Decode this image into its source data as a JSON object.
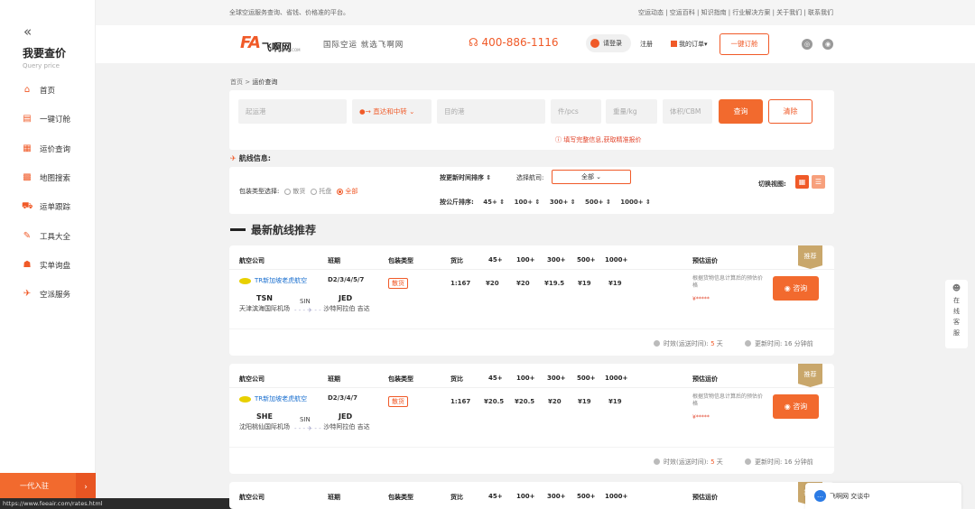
{
  "sidebar": {
    "collapse_glyph": "«",
    "title": "我要查价",
    "subtitle": "Query price",
    "items": [
      {
        "label": "首页",
        "icon": "home-icon",
        "glyph": "⌂"
      },
      {
        "label": "一键订舱",
        "icon": "booking-icon",
        "glyph": "▤"
      },
      {
        "label": "运价查询",
        "icon": "freight-rate-icon",
        "glyph": "▦"
      },
      {
        "label": "地图搜索",
        "icon": "map-icon",
        "glyph": "▩"
      },
      {
        "label": "运单跟踪",
        "icon": "truck-icon",
        "glyph": "⛟"
      },
      {
        "label": "工具大全",
        "icon": "wrench-icon",
        "glyph": "✎"
      },
      {
        "label": "实单询盘",
        "icon": "inquiry-icon",
        "glyph": "☗"
      },
      {
        "label": "空派服务",
        "icon": "plane-icon",
        "glyph": "✈"
      }
    ],
    "join_label": "一代入驻",
    "join_arrow": "›"
  },
  "status_url": "https://www.feeair.com/rates.html",
  "topbar": {
    "left_text": "全球空运服务查询、省钱、价格准的平台。",
    "right_text": "空运动态 | 空运百科 | 知识指南 | 行业解决方案 | 关于我们 | 联系我们"
  },
  "header": {
    "logo_mark": "FA",
    "logo_text": "飞啊网",
    "logo_url": "FEEAIR.COM",
    "slogan": "国际空运 就选飞啊网",
    "phone": "☊ 400-886-1116",
    "login": "请登录",
    "register": "注册",
    "my_orders": "我的订单▾",
    "booking_button": "一键订舱",
    "wechat_glyph": "◎",
    "weibo_glyph": "◉"
  },
  "breadcrumb": {
    "home": "首页",
    "sep": ">",
    "current": "运价查询"
  },
  "search": {
    "origin_placeholder": "起运港",
    "route_value": "●→ 直达和中转 ⌄",
    "destination_placeholder": "目的港",
    "pcs_placeholder": "件/pcs",
    "weight_placeholder": "重量/kg",
    "volume_placeholder": "体积/CBM",
    "query_button": "查询",
    "clear_button": "清除",
    "hint": "ⓘ 填写完整信息,获取精准报价"
  },
  "route_info_label": "航线信息:",
  "route_info_icon": "✈",
  "filters": {
    "pack_type_label": "包装类型选择:",
    "pack_options": [
      {
        "label": "散货",
        "checked": false
      },
      {
        "label": "托盘",
        "checked": false
      },
      {
        "label": "全部",
        "checked": true
      }
    ],
    "sort_update_label": "按更新时间排序 ⇕",
    "airline_label": "选择航司:",
    "airline_selected": "全部 ⌄",
    "sort_kg_label": "按公斤排序:",
    "sort_kg_options": [
      "45+ ⇕",
      "100+ ⇕",
      "300+ ⇕",
      "500+ ⇕",
      "1000+ ⇕"
    ],
    "view_label": "切换视图:",
    "view_grid_glyph": "▦",
    "view_list_glyph": "☰"
  },
  "latest_title": "最新航线推荐",
  "table_headers": [
    "航空公司",
    "班期",
    "包装类型",
    "货比",
    "45+",
    "100+",
    "300+",
    "500+",
    "1000+",
    "预估运价"
  ],
  "cards": [
    {
      "airline": "TR新加坡老虎航空",
      "origin_code": "TSN",
      "origin_name": "天津滨海国际机场",
      "transit": "SIN",
      "dest_code": "JED",
      "dest_name": "沙特阿拉伯 吉达",
      "arrow_line": "- - - ✈ - - -",
      "schedule": "D2/3/4/5/7",
      "pack": "散货",
      "ratio": "1:167",
      "prices": [
        "¥20",
        "¥20",
        "¥19.5",
        "¥19",
        "¥19"
      ],
      "estimate_note": "根据货物信息计算后的预估价格",
      "stars": "¥*****",
      "consult": "◉ 咨询",
      "recommend": "推荐",
      "transit_time_label": "时效(运送时间):",
      "transit_time_value": "5",
      "transit_time_unit": "天",
      "update_label": "更新时间:",
      "update_value": "16 分钟前"
    },
    {
      "airline": "TR新加坡老虎航空",
      "origin_code": "SHE",
      "origin_name": "沈阳桃仙国际机场",
      "transit": "SIN",
      "dest_code": "JED",
      "dest_name": "沙特阿拉伯 吉达",
      "arrow_line": "- - - ✈ - - -",
      "schedule": "D2/3/4/7",
      "pack": "散货",
      "ratio": "1:167",
      "prices": [
        "¥20.5",
        "¥20.5",
        "¥20",
        "¥19",
        "¥19"
      ],
      "estimate_note": "根据货物信息计算后的预估价格",
      "stars": "¥*****",
      "consult": "◉ 咨询",
      "recommend": "推荐",
      "transit_time_label": "时效(运送时间):",
      "transit_time_value": "5",
      "transit_time_unit": "天",
      "update_label": "更新时间:",
      "update_value": "16 分钟前"
    },
    {
      "recommend": "推荐"
    }
  ],
  "side_service": {
    "glyph": "☻",
    "text": "在线客服"
  },
  "chat": {
    "glyph": "…",
    "label": "飞啊网 交谈中"
  },
  "colors": {
    "accent": "#f26a2e",
    "link": "#1a6fcf",
    "badge": "#c9a76b"
  }
}
